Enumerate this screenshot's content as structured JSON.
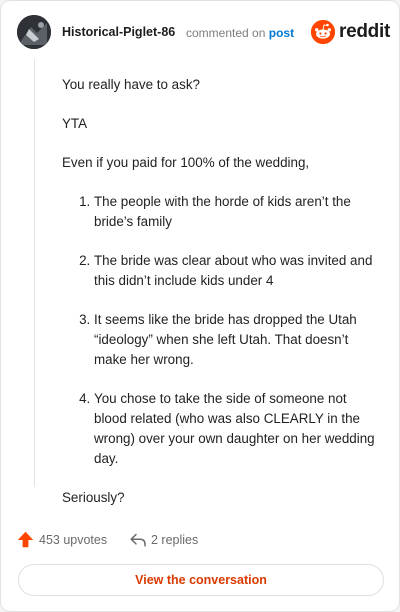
{
  "header": {
    "username": "Historical-Piglet-86",
    "commented_on": "commented on",
    "post_link": "post",
    "brand": "reddit"
  },
  "comment": {
    "paragraphs_before": [
      "You really have to ask?",
      "YTA",
      "Even if you paid for 100% of the wedding,"
    ],
    "list_items": [
      "The people with the horde of kids aren’t the bride’s family",
      "The bride was clear about who was invited and this didn’t include kids under 4",
      "It seems like the bride has dropped the Utah “ideology” when she left Utah. That doesn’t make her wrong.",
      "You chose to take the side of someone not blood related (who was also CLEARLY in the wrong) over your own daughter on her wedding day."
    ],
    "closing": "Seriously?"
  },
  "footer": {
    "upvotes": "453 upvotes",
    "replies": "2 replies"
  },
  "cta": {
    "label": "View the conversation"
  },
  "colors": {
    "accent": "#ff4500",
    "link": "#0079d3",
    "cta_text": "#d93a00",
    "upvote": "#ff4500"
  },
  "icons": [
    "avatar",
    "reddit-logo-icon",
    "upvote-arrow-icon",
    "reply-arrow-icon"
  ]
}
